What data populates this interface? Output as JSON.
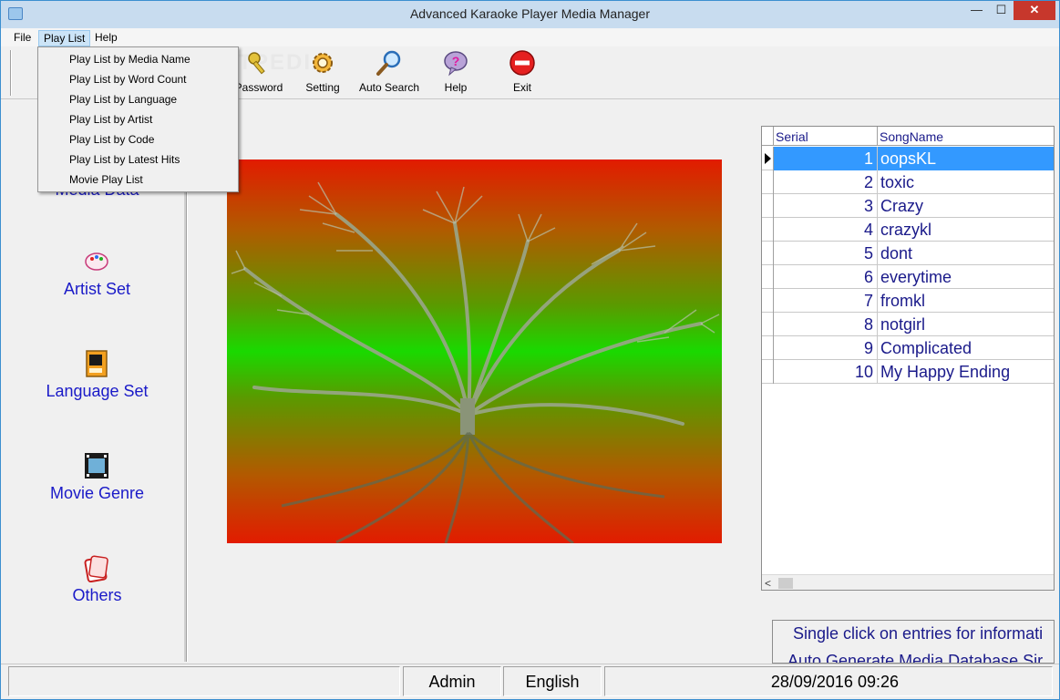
{
  "window": {
    "title": "Advanced Karaoke Player Media Manager",
    "min_glyph": "—",
    "max_glyph": "☐",
    "close_glyph": "✕"
  },
  "menu": {
    "file": "File",
    "play_list": "Play List",
    "help": "Help"
  },
  "dropdown": {
    "items": [
      "Play List by Media Name",
      "Play List by Word Count",
      "Play List by Language",
      "Play List by Artist",
      "Play List by Code",
      "Play List by Latest Hits",
      "Movie Play List"
    ]
  },
  "toolbar": {
    "watermark": "SOFTPEDIA",
    "password_label": "Password",
    "setting_label": "Setting",
    "auto_search_label": "Auto Search",
    "help_label": "Help",
    "exit_label": "Exit",
    "help_glyph": "?"
  },
  "sidebar": {
    "media_data": "Media Data",
    "artist_set": "Artist Set",
    "language_set": "Language Set",
    "movie_genre": "Movie Genre",
    "others": "Others"
  },
  "grid": {
    "header_serial": "Serial",
    "header_song": "SongName",
    "rows": [
      {
        "serial": "1",
        "song": "oopsKL"
      },
      {
        "serial": "2",
        "song": "toxic"
      },
      {
        "serial": "3",
        "song": "Crazy"
      },
      {
        "serial": "4",
        "song": "crazykl"
      },
      {
        "serial": "5",
        "song": "dont"
      },
      {
        "serial": "6",
        "song": "everytime"
      },
      {
        "serial": "7",
        "song": "fromkl"
      },
      {
        "serial": "8",
        "song": "notgirl"
      },
      {
        "serial": "9",
        "song": "Complicated"
      },
      {
        "serial": "10",
        "song": "My Happy Ending"
      }
    ],
    "scroll_left_glyph": "<"
  },
  "info": {
    "line1": "Single click on entries for informati",
    "line2": "Auto Generate Media Database Sir"
  },
  "status": {
    "user": "Admin",
    "language": "English",
    "datetime": "28/09/2016   09:26"
  },
  "colors": {
    "link_text": "#1a1ac8",
    "grid_text": "#1a1a8a",
    "selection": "#3399ff",
    "close_button": "#c7372c"
  }
}
